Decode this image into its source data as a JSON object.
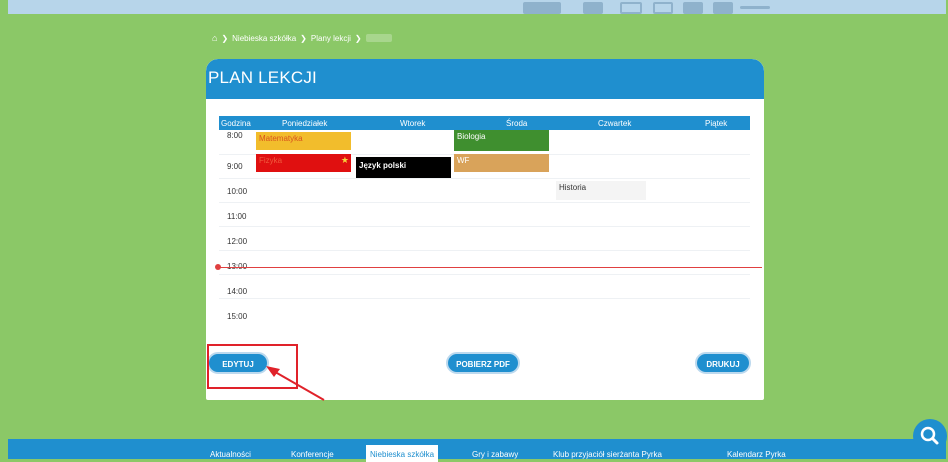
{
  "breadcrumb": {
    "items": [
      "Niebieska szkółka",
      "Plany lekcji"
    ]
  },
  "card": {
    "title": "PLAN LEKCJI"
  },
  "table": {
    "headers": [
      "Godzina",
      "Poniedziałek",
      "Wtorek",
      "Środa",
      "Czwartek",
      "Piątek"
    ],
    "hours": [
      "8:00",
      "9:00",
      "10:00",
      "11:00",
      "12:00",
      "13:00",
      "14:00",
      "15:00"
    ],
    "events": [
      {
        "label": "Matematyka",
        "day": "Poniedziałek",
        "color": "#f2bd2c",
        "text_color": "#d9531e"
      },
      {
        "label": "Fizyka",
        "day": "Poniedziałek",
        "color": "#e01010",
        "text_color": "#f05a3c"
      },
      {
        "label": "Język polski",
        "day": "Wtorek",
        "color": "#000000",
        "text_color": "#ffffff"
      },
      {
        "label": "Biologia",
        "day": "Środa",
        "color": "#3f8f2f",
        "text_color": "#ffffff"
      },
      {
        "label": "WF",
        "day": "Środa",
        "color": "#d9a35a",
        "text_color": "#ffffff"
      },
      {
        "label": "Historia",
        "day": "Czwartek",
        "color": "#f4f4f4",
        "text_color": "#333333"
      }
    ]
  },
  "buttons": {
    "edit": "EDYTUJ",
    "pdf": "POBIERZ PDF",
    "print": "DRUKUJ"
  },
  "footer": {
    "items": [
      "Aktualności",
      "Konferencje",
      "Niebieska szkółka",
      "Gry i zabawy",
      "Klub przyjaciół sierżanta Pyrka",
      "Kalendarz Pyrka"
    ],
    "active": "Niebieska szkółka"
  },
  "colors": {
    "background": "#8bc867",
    "accent": "#1f8fcf",
    "now_line": "#e04040",
    "annotation": "#e0222a"
  }
}
